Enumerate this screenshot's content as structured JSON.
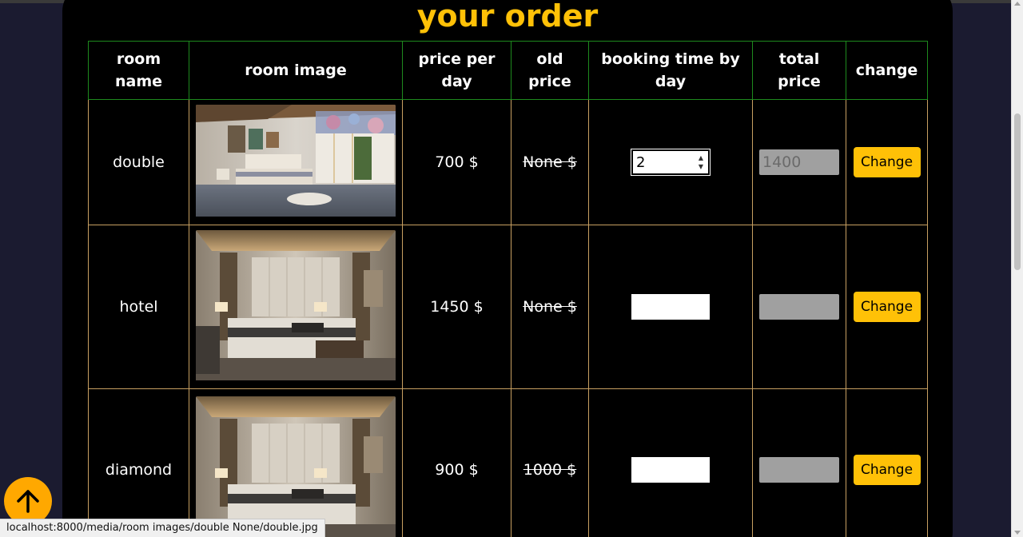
{
  "page": {
    "title": "your order"
  },
  "table": {
    "headers": {
      "room_name": "room name",
      "room_image": "room image",
      "price_per_day": "price per day",
      "old_price": "old price",
      "booking_time": "booking time by day",
      "total_price": "total price",
      "change": "change"
    },
    "rows": [
      {
        "name": "double",
        "image": "bedroom photo - white bedroom with floral wall",
        "price": "700 $",
        "old_price": "None $",
        "days": "2",
        "total": "1400",
        "button": "Change"
      },
      {
        "name": "hotel",
        "image": "bedroom photo - hotel room with lamps",
        "price": "1450 $",
        "old_price": "None $",
        "days": "",
        "total": "",
        "button": "Change"
      },
      {
        "name": "diamond",
        "image": "bedroom photo - hotel room with lamps",
        "price": "900 $",
        "old_price": "1000 $",
        "days": "",
        "total": "",
        "button": "Change"
      }
    ]
  },
  "status_bar": {
    "url": "localhost:8000/media/room images/double None/double.jpg"
  },
  "colors": {
    "accent": "#ffc107",
    "header_border": "#1e8a1e",
    "cell_border": "#c8a062",
    "panel": "#000000",
    "page_bg": "#1b1b30"
  },
  "icons": {
    "back_to_top": "arrow-up-icon"
  }
}
